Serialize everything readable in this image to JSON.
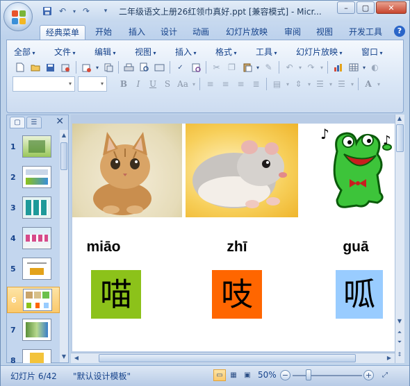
{
  "window": {
    "title": "二年级语文上册26红领巾真好.ppt [兼容模式] - Micr...",
    "controls": [
      "–",
      "▢",
      "✕"
    ]
  },
  "quick_access": [
    "save-icon",
    "undo-icon",
    "redo-icon",
    "customize-icon"
  ],
  "tabs": [
    {
      "label": "经典菜单",
      "active": true
    },
    {
      "label": "开始"
    },
    {
      "label": "插入"
    },
    {
      "label": "设计"
    },
    {
      "label": "动画"
    },
    {
      "label": "幻灯片放映"
    },
    {
      "label": "审阅"
    },
    {
      "label": "视图"
    },
    {
      "label": "开发工具"
    }
  ],
  "help": "?",
  "menus": [
    "全部",
    "文件",
    "编辑",
    "视图",
    "插入",
    "格式",
    "工具",
    "幻灯片放映",
    "窗口"
  ],
  "format_buttons": {
    "bold": "B",
    "italic": "I",
    "underline": "U",
    "strike": "S",
    "case": "Aa",
    "font_color": "A"
  },
  "nav": {
    "close": "✕"
  },
  "thumbnails": [
    {
      "num": "1"
    },
    {
      "num": "2"
    },
    {
      "num": "3"
    },
    {
      "num": "4"
    },
    {
      "num": "5"
    },
    {
      "num": "6",
      "selected": true
    },
    {
      "num": "7"
    },
    {
      "num": "8"
    }
  ],
  "slide": {
    "items": [
      {
        "pinyin": "miāo",
        "hanzi": "喵",
        "color": "#8cc21a"
      },
      {
        "pinyin": "zhī",
        "hanzi": "吱",
        "color": "#ff6600"
      },
      {
        "pinyin": "guā",
        "hanzi": "呱",
        "color": "#99ccff"
      }
    ]
  },
  "status": {
    "slide_info": "幻灯片 6/42",
    "template": "\"默认设计模板\"",
    "zoom": "50%",
    "zoom_out": "−",
    "zoom_in": "+"
  }
}
